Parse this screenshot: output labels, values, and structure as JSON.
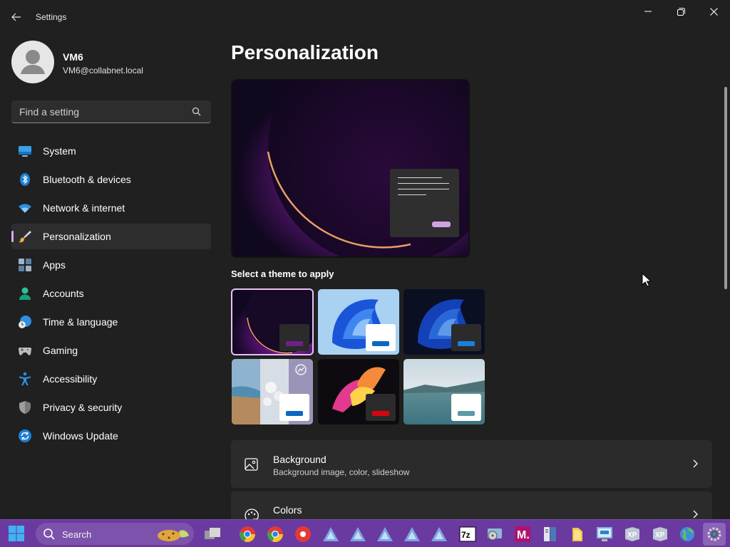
{
  "window": {
    "title": "Settings"
  },
  "profile": {
    "name": "VM6",
    "email": "VM6@collabnet.local"
  },
  "search": {
    "placeholder": "Find a setting"
  },
  "nav": {
    "items": [
      {
        "label": "System",
        "icon": "monitor-icon"
      },
      {
        "label": "Bluetooth & devices",
        "icon": "bluetooth-icon"
      },
      {
        "label": "Network & internet",
        "icon": "wifi-icon"
      },
      {
        "label": "Personalization",
        "icon": "paintbrush-icon",
        "selected": true
      },
      {
        "label": "Apps",
        "icon": "apps-icon"
      },
      {
        "label": "Accounts",
        "icon": "person-icon"
      },
      {
        "label": "Time & language",
        "icon": "clock-globe-icon"
      },
      {
        "label": "Gaming",
        "icon": "gamepad-icon"
      },
      {
        "label": "Accessibility",
        "icon": "accessibility-icon"
      },
      {
        "label": "Privacy & security",
        "icon": "shield-icon"
      },
      {
        "label": "Windows Update",
        "icon": "update-icon"
      }
    ]
  },
  "main": {
    "title": "Personalization",
    "themes_label": "Select a theme to apply",
    "themes": [
      {
        "name": "glow-dark",
        "accent": "#6e1f8a",
        "selected": true
      },
      {
        "name": "bloom-light",
        "accent": "#0a67c2"
      },
      {
        "name": "bloom-dark",
        "accent": "#1b7fd9"
      },
      {
        "name": "spotlight",
        "accent": "#0a67c2"
      },
      {
        "name": "flow",
        "accent": "#d4060b"
      },
      {
        "name": "sunrise",
        "accent": "#5c9aa6"
      }
    ],
    "rows": [
      {
        "title": "Background",
        "subtitle": "Background image, color, slideshow",
        "icon": "image-icon"
      },
      {
        "title": "Colors",
        "subtitle": "",
        "icon": "palette-icon"
      }
    ]
  },
  "taskbar": {
    "search_label": "Search",
    "apps": [
      "task-view-icon",
      "chrome-icon",
      "chrome-icon",
      "recorder-icon",
      "app-icon",
      "app-icon",
      "app-icon",
      "app-icon",
      "app-icon",
      "7zip-icon",
      "disk-icon",
      "m-icon",
      "book-icon",
      "folder-icon",
      "remote-desktop-icon",
      "xp-icon",
      "xp-icon",
      "globe-icon",
      "settings-icon"
    ]
  },
  "colors": {
    "accent": "#d7a6f5",
    "taskbar": "#6a3aa0",
    "background": "#202020"
  }
}
